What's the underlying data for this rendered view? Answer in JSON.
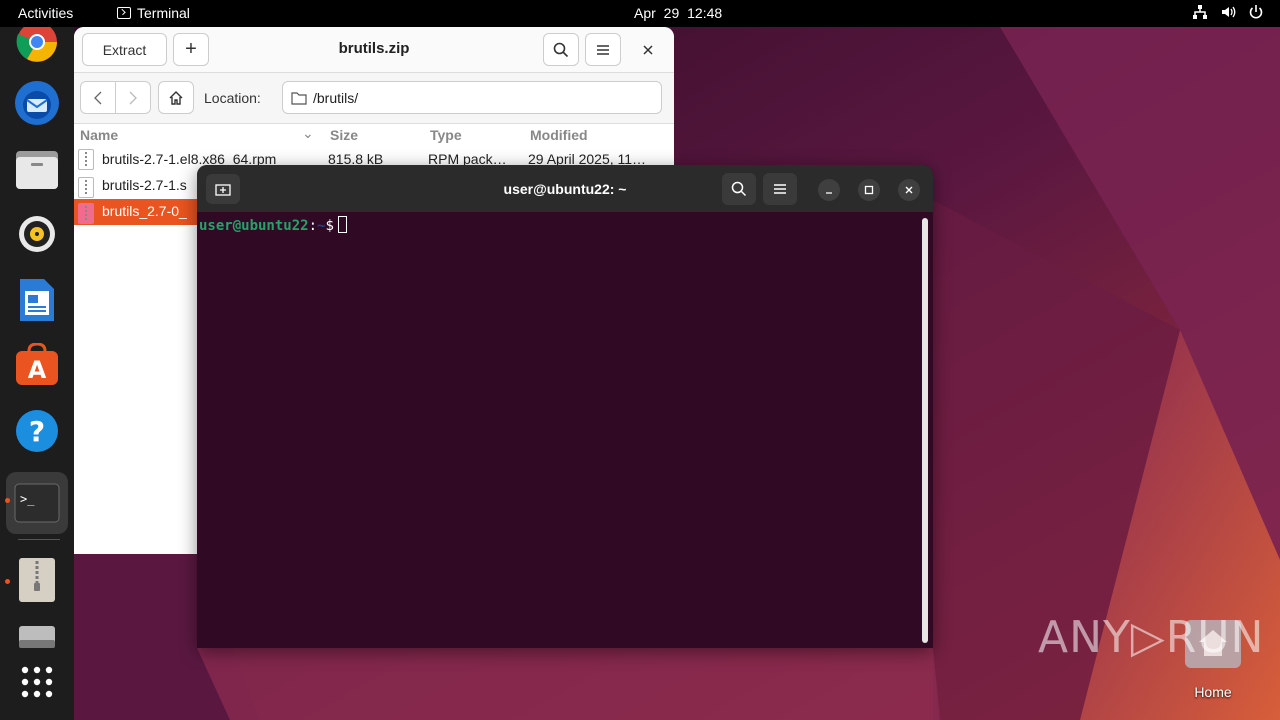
{
  "topbar": {
    "activities": "Activities",
    "app_name": "Terminal",
    "clock": "Apr 29  12:48"
  },
  "dock": {
    "items": [
      "chrome",
      "thunderbird",
      "files",
      "rhythmbox",
      "writer",
      "software",
      "help",
      "terminal",
      "archive-manager",
      "usb-drive",
      "show-apps"
    ]
  },
  "archive": {
    "extract_label": "Extract",
    "title": "brutils.zip",
    "location_label": "Location:",
    "location_path": "/brutils/",
    "columns": {
      "name": "Name",
      "size": "Size",
      "type": "Type",
      "modified": "Modified"
    },
    "rows": [
      {
        "name": "brutils-2.7-1.el8.x86_64.rpm",
        "size": "815.8 kB",
        "type": "RPM pack…",
        "modified": "29 April 2025, 11…"
      },
      {
        "name": "brutils-2.7-1.s",
        "size": "",
        "type": "",
        "modified": ""
      },
      {
        "name": "brutils_2.7-0_",
        "size": "",
        "type": "",
        "modified": ""
      }
    ]
  },
  "terminal": {
    "title": "user@ubuntu22: ~",
    "prompt_user": "user@ubuntu22",
    "prompt_sep": ":",
    "prompt_path": "~",
    "prompt_dollar": "$"
  },
  "desktop": {
    "home_label": "Home",
    "watermark": "ANY▷RUN"
  },
  "colors": {
    "accent": "#e95420",
    "terminal_bg": "#300a24"
  }
}
